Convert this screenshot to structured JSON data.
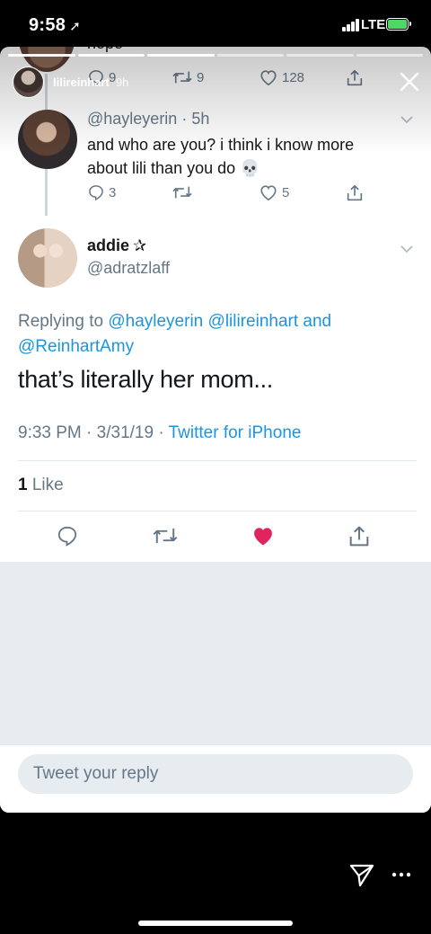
{
  "status_bar": {
    "time": "9:58",
    "network": "LTE"
  },
  "story": {
    "username": "lilireinhart",
    "age": "9h"
  },
  "previous_tweet": {
    "text": "nope",
    "replies": "9",
    "retweets": "9",
    "likes": "128"
  },
  "parent_tweet": {
    "handle": "@hayleyerin",
    "age": "5h",
    "text": "and who are you? i think i know more about lili than you do 💀",
    "replies": "3",
    "likes": "5"
  },
  "focal_tweet": {
    "name": "addie",
    "name_emoji": "✰",
    "handle": "@adratzlaff",
    "replying_prefix": "Replying to",
    "mention1": "@hayleyerin",
    "mention2": "@lilireinhart",
    "and": "and",
    "mention3": "@ReinhartAmy",
    "text": "that’s literally her mom...",
    "time": "9:33 PM",
    "date": "3/31/19",
    "source": "Twitter for iPhone",
    "like_count": "1",
    "like_label": "Like"
  },
  "reply": {
    "placeholder": "Tweet your reply"
  },
  "colors": {
    "link": "#1b95e0",
    "secondary_text": "#657786",
    "like_active": "#e0245e",
    "divider": "#e1e8ed",
    "background_gray": "#e6ecf0"
  },
  "icons": [
    "reply-icon",
    "retweet-icon",
    "like-icon",
    "share-icon",
    "chevron-down-icon",
    "close-icon",
    "send-icon",
    "more-icon"
  ]
}
